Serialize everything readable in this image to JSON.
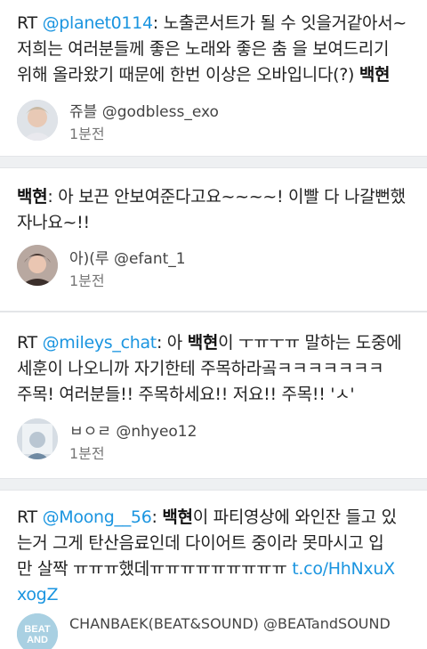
{
  "tweets": [
    {
      "prefix": "RT ",
      "mention": "@planet0114",
      "line1_rest": ": 노출콘서트가 될 수 잇을거같아서~",
      "line2": "저희는 여러분들께 좋은 노래와 좋은 춤 을 보여드리기",
      "line3_a": "위해 올라왔기 때문에 한번 이상은 오바입니다(?) ",
      "line3_kw": "백현",
      "display_name": "쥬블",
      "handle": "@godbless_exo",
      "time": "1분전"
    },
    {
      "kw": "백현",
      "line1_rest": ": 아 보끈 안보여준다고요~~~~! 이빨 다 나갈뻔했",
      "line2": "자나요~!!",
      "display_name": "아)(루",
      "handle": "@efant_1",
      "time": "1분전"
    },
    {
      "prefix": "RT ",
      "mention": "@mileys_chat",
      "line1_mid": ": 아 ",
      "kw": "백현",
      "line1_rest": "이 ㅜㅠㅜㅠ 말하는 도중에",
      "line2": "세훈이 나오니까 자기한테 주목하라곸ㅋㅋㅋㅋㅋㅋㅋ",
      "line3": "주목! 여러분들!! 주목하세요!! 저요!! 주목!! 'ㅅ'",
      "display_name": "ㅂㅇㄹ",
      "handle": "@nhyeo12",
      "time": "1분전"
    },
    {
      "prefix": "RT ",
      "mention": "@Moong__56",
      "line1_mid": ": ",
      "kw": "백현",
      "line1_rest": "이 파티영상에 와인잔 들고 있",
      "line2": "는거 그게 탄산음료인데 다이어트 중이라 못마시고 입",
      "line3_a": "만 살짝 ㅠㅠㅠ했데ㅠㅠㅠㅠㅠㅠㅠㅠㅠ ",
      "link_a": "t.co/HhNxuX",
      "link_b": "xogZ",
      "display_name": "CHANBAEK(BEAT&SOUND)",
      "handle": "@BEATandSOUND",
      "avatar_text_1": "BEAT",
      "avatar_text_2": "AND"
    }
  ],
  "colors": {
    "mention": "#1b95e0",
    "background": "#eef0f2"
  }
}
